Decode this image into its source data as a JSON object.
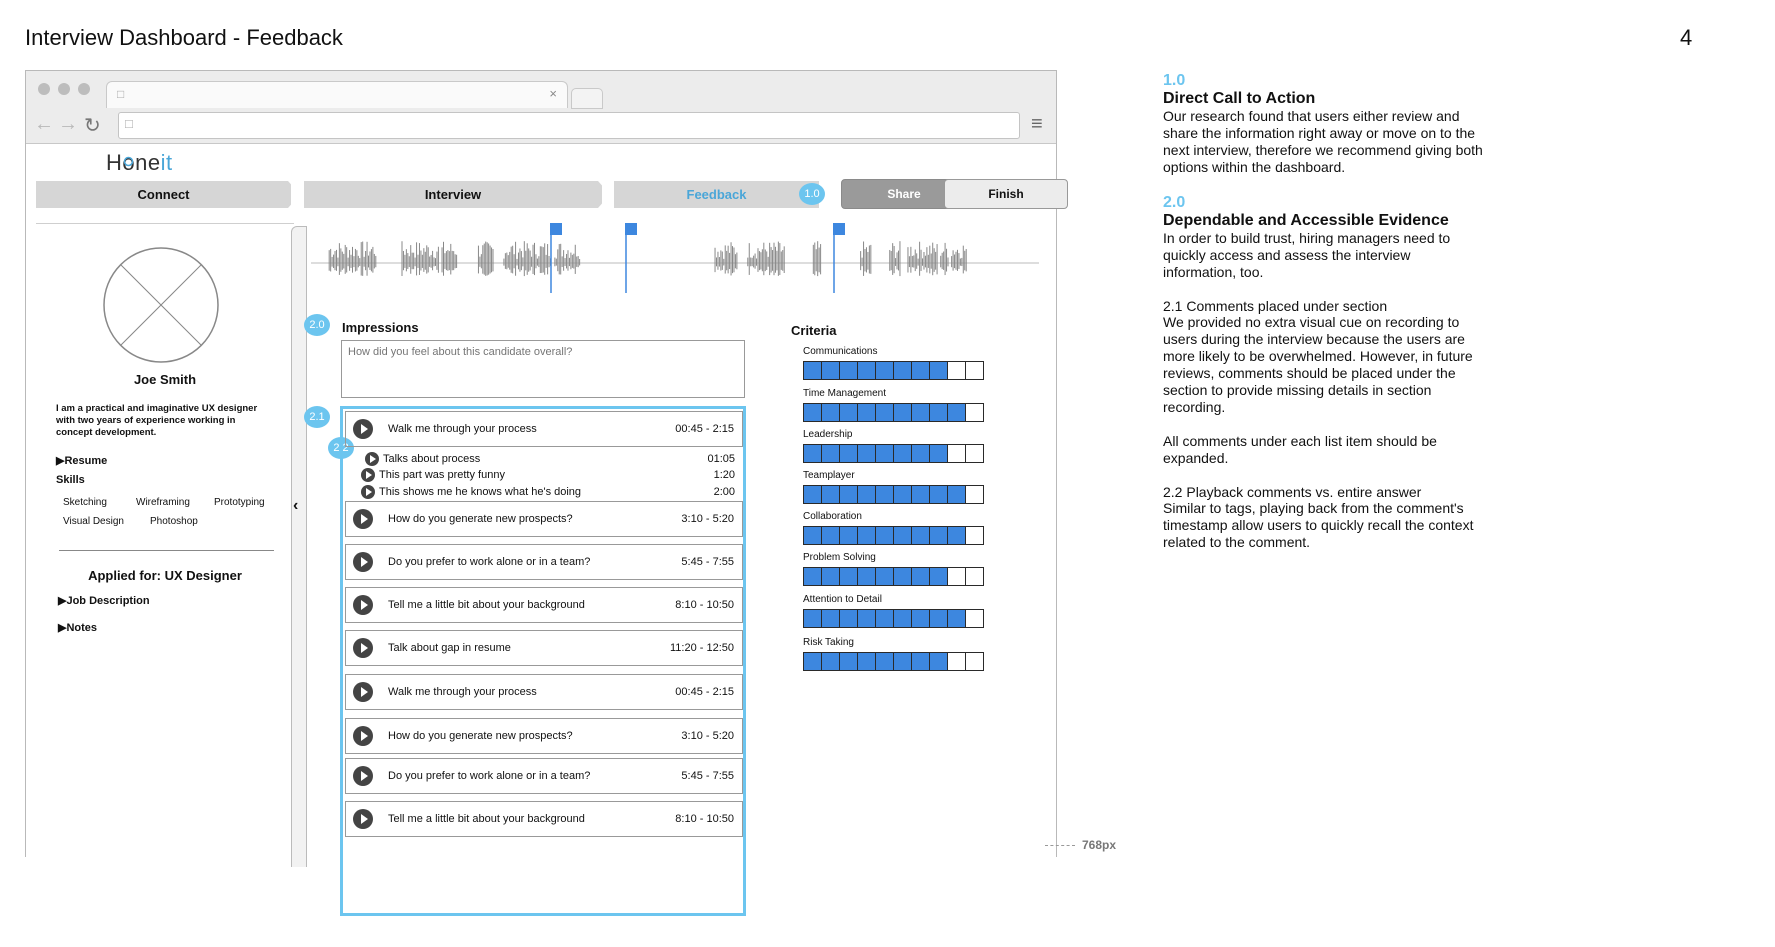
{
  "page": {
    "title": "Interview Dashboard - Feedback",
    "number": "4"
  },
  "header": {
    "logo_left": "H",
    "logo_mid": "ne",
    "logo_it": "it",
    "steps": [
      "Connect",
      "Interview",
      "Feedback"
    ],
    "share_label": "Share",
    "finish_label": "Finish"
  },
  "badges": {
    "b10": "1.0",
    "b20": "2.0",
    "b21": "2.1",
    "b22": "2.2"
  },
  "candidate": {
    "name": "Joe Smith",
    "bio": "I am a practical and imaginative UX designer with two years of experience working in concept development.",
    "resume_label": "Resume",
    "skills_title": "Skills",
    "skills": [
      "Sketching",
      "Wireframing",
      "Prototyping",
      "Visual Design",
      "Photoshop"
    ],
    "applied_for": "Applied for: UX Designer",
    "job_description_label": "Job Description",
    "notes_label": "Notes"
  },
  "impressions": {
    "title": "Impressions",
    "placeholder": "How did you feel about this candidate overall?"
  },
  "questions": [
    {
      "text": "Walk me through your process",
      "time": "00:45 - 2:15"
    },
    {
      "text": "How do you generate new prospects?",
      "time": "3:10 - 5:20"
    },
    {
      "text": "Do you prefer to work alone or in a team?",
      "time": "5:45 - 7:55"
    },
    {
      "text": "Tell me a little bit about your background",
      "time": "8:10 - 10:50"
    },
    {
      "text": "Talk about gap in resume",
      "time": "11:20 - 12:50"
    },
    {
      "text": "Walk me through your process",
      "time": "00:45 - 2:15"
    },
    {
      "text": "How do you generate new prospects?",
      "time": "3:10 - 5:20"
    },
    {
      "text": "Do you prefer to work alone or in a team?",
      "time": "5:45 - 7:55"
    },
    {
      "text": "Tell me a little bit about your background",
      "time": "8:10 - 10:50"
    }
  ],
  "comments": [
    {
      "text": "Talks about process",
      "time": "01:05"
    },
    {
      "text": "This part was pretty funny",
      "time": "1:20"
    },
    {
      "text": "This shows me he knows what he's doing",
      "time": "2:00"
    }
  ],
  "criteria": {
    "title": "Criteria",
    "items": [
      {
        "label": "Communications",
        "filled": 8,
        "total": 10
      },
      {
        "label": "Time Management",
        "filled": 9,
        "total": 10
      },
      {
        "label": "Leadership",
        "filled": 8,
        "total": 10
      },
      {
        "label": "Teamplayer",
        "filled": 9,
        "total": 10
      },
      {
        "label": "Collaboration",
        "filled": 9,
        "total": 10
      },
      {
        "label": "Problem Solving",
        "filled": 8,
        "total": 10
      },
      {
        "label": "Attention to Detail",
        "filled": 9,
        "total": 10
      },
      {
        "label": "Risk Taking",
        "filled": 8,
        "total": 10
      }
    ]
  },
  "viewport_label": "768px",
  "notes": {
    "n10_num": "1.0",
    "n10_title": "Direct Call to Action",
    "n10_body": "Our research found that users either review and share the information right away or move on to the next interview, therefore we recommend giving both options within the dashboard.",
    "n20_num": "2.0",
    "n20_title": "Dependable and Accessible Evidence",
    "n20_body": "In order to build trust, hiring managers need to quickly access and assess the interview information, too.",
    "n21_title": "2.1 Comments placed under section",
    "n21_body": "We provided no extra visual cue on recording to users during the interview because the users are more likely to be overwhelmed. However, in future reviews, comments should be placed under the section to provide missing details in section recording.",
    "n21_body2": "All comments under each list item should be expanded.",
    "n22_title": "2.2 Playback comments vs. entire answer",
    "n22_body": "Similar to tags, playing back from the comment's timestamp allow users to quickly recall the context related to the comment."
  }
}
